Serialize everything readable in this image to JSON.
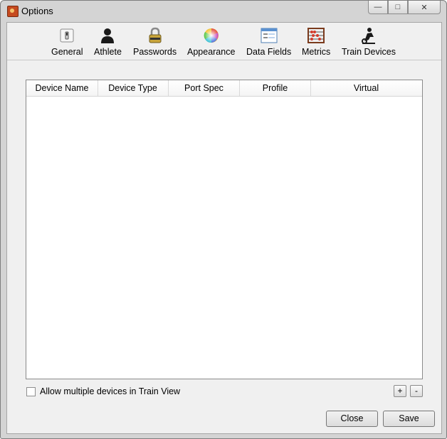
{
  "window": {
    "title": "Options",
    "controls": {
      "minimize": "—",
      "maximize": "□",
      "close": "✕"
    }
  },
  "toolbar": {
    "items": [
      {
        "label": "General",
        "icon": "switch-icon"
      },
      {
        "label": "Athlete",
        "icon": "person-icon"
      },
      {
        "label": "Passwords",
        "icon": "padlock-icon"
      },
      {
        "label": "Appearance",
        "icon": "color-wheel-icon"
      },
      {
        "label": "Data Fields",
        "icon": "form-window-icon"
      },
      {
        "label": "Metrics",
        "icon": "abacus-icon"
      },
      {
        "label": "Train Devices",
        "icon": "trainer-icon"
      }
    ]
  },
  "devices_table": {
    "columns": [
      "Device Name",
      "Device Type",
      "Port Spec",
      "Profile",
      "Virtual"
    ],
    "rows": []
  },
  "footer": {
    "allow_multiple_label": "Allow multiple devices in Train View",
    "allow_multiple_checked": false,
    "add_label": "+",
    "remove_label": "-",
    "close_label": "Close",
    "save_label": "Save"
  },
  "colors": {
    "chrome": "#d4d4d4",
    "client_bg": "#f0f0f0",
    "table_bg": "#ffffff"
  }
}
